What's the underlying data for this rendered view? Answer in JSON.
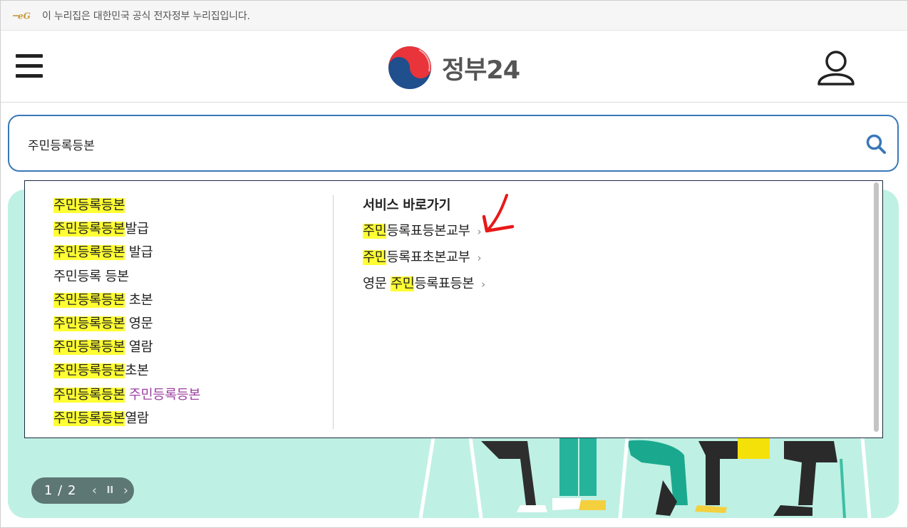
{
  "notice": {
    "text": "이 누리집은 대한민국 공식 전자정부 누리집입니다."
  },
  "header": {
    "logo_text": "정부24",
    "menu_icon": "hamburger-menu-icon",
    "user_icon": "user-icon"
  },
  "search": {
    "value": "주민등록등본",
    "icon": "search-icon"
  },
  "suggestions": [
    {
      "hl": "주민등록등본",
      "rest": ""
    },
    {
      "hl": "주민등록등본",
      "rest": "발급"
    },
    {
      "hl": "주민등록등본",
      "rest": " 발급"
    },
    {
      "hl": "",
      "rest": "주민등록 등본"
    },
    {
      "hl": "주민등록등본",
      "rest": " 초본"
    },
    {
      "hl": "주민등록등본",
      "rest": " 영문"
    },
    {
      "hl": "주민등록등본",
      "rest": " 열람"
    },
    {
      "hl": "주민등록등본",
      "rest": "초본"
    },
    {
      "hl": "주민등록등본",
      "rest": " ",
      "pink": "주민등록등본"
    },
    {
      "hl": "주민등록등본",
      "rest": "열람"
    }
  ],
  "quick_links": {
    "title": "서비스 바로가기",
    "items": [
      {
        "pre": "",
        "hl": "주민",
        "rest": "등록표등본교부"
      },
      {
        "pre": "",
        "hl": "주민",
        "rest": "등록표초본교부"
      },
      {
        "pre": "영문 ",
        "hl": "주민",
        "rest": "등록표등본"
      }
    ],
    "chevron": "›"
  },
  "banner": {
    "pager_text": "1 / 2",
    "prev": "‹",
    "pause": "II",
    "next": "›",
    "bg_color": "#bff0e4"
  },
  "colors": {
    "highlight": "#ffff33",
    "search_border": "#3a78b8",
    "accent_red": "#e8343a",
    "accent_blue": "#1f4f8c"
  }
}
